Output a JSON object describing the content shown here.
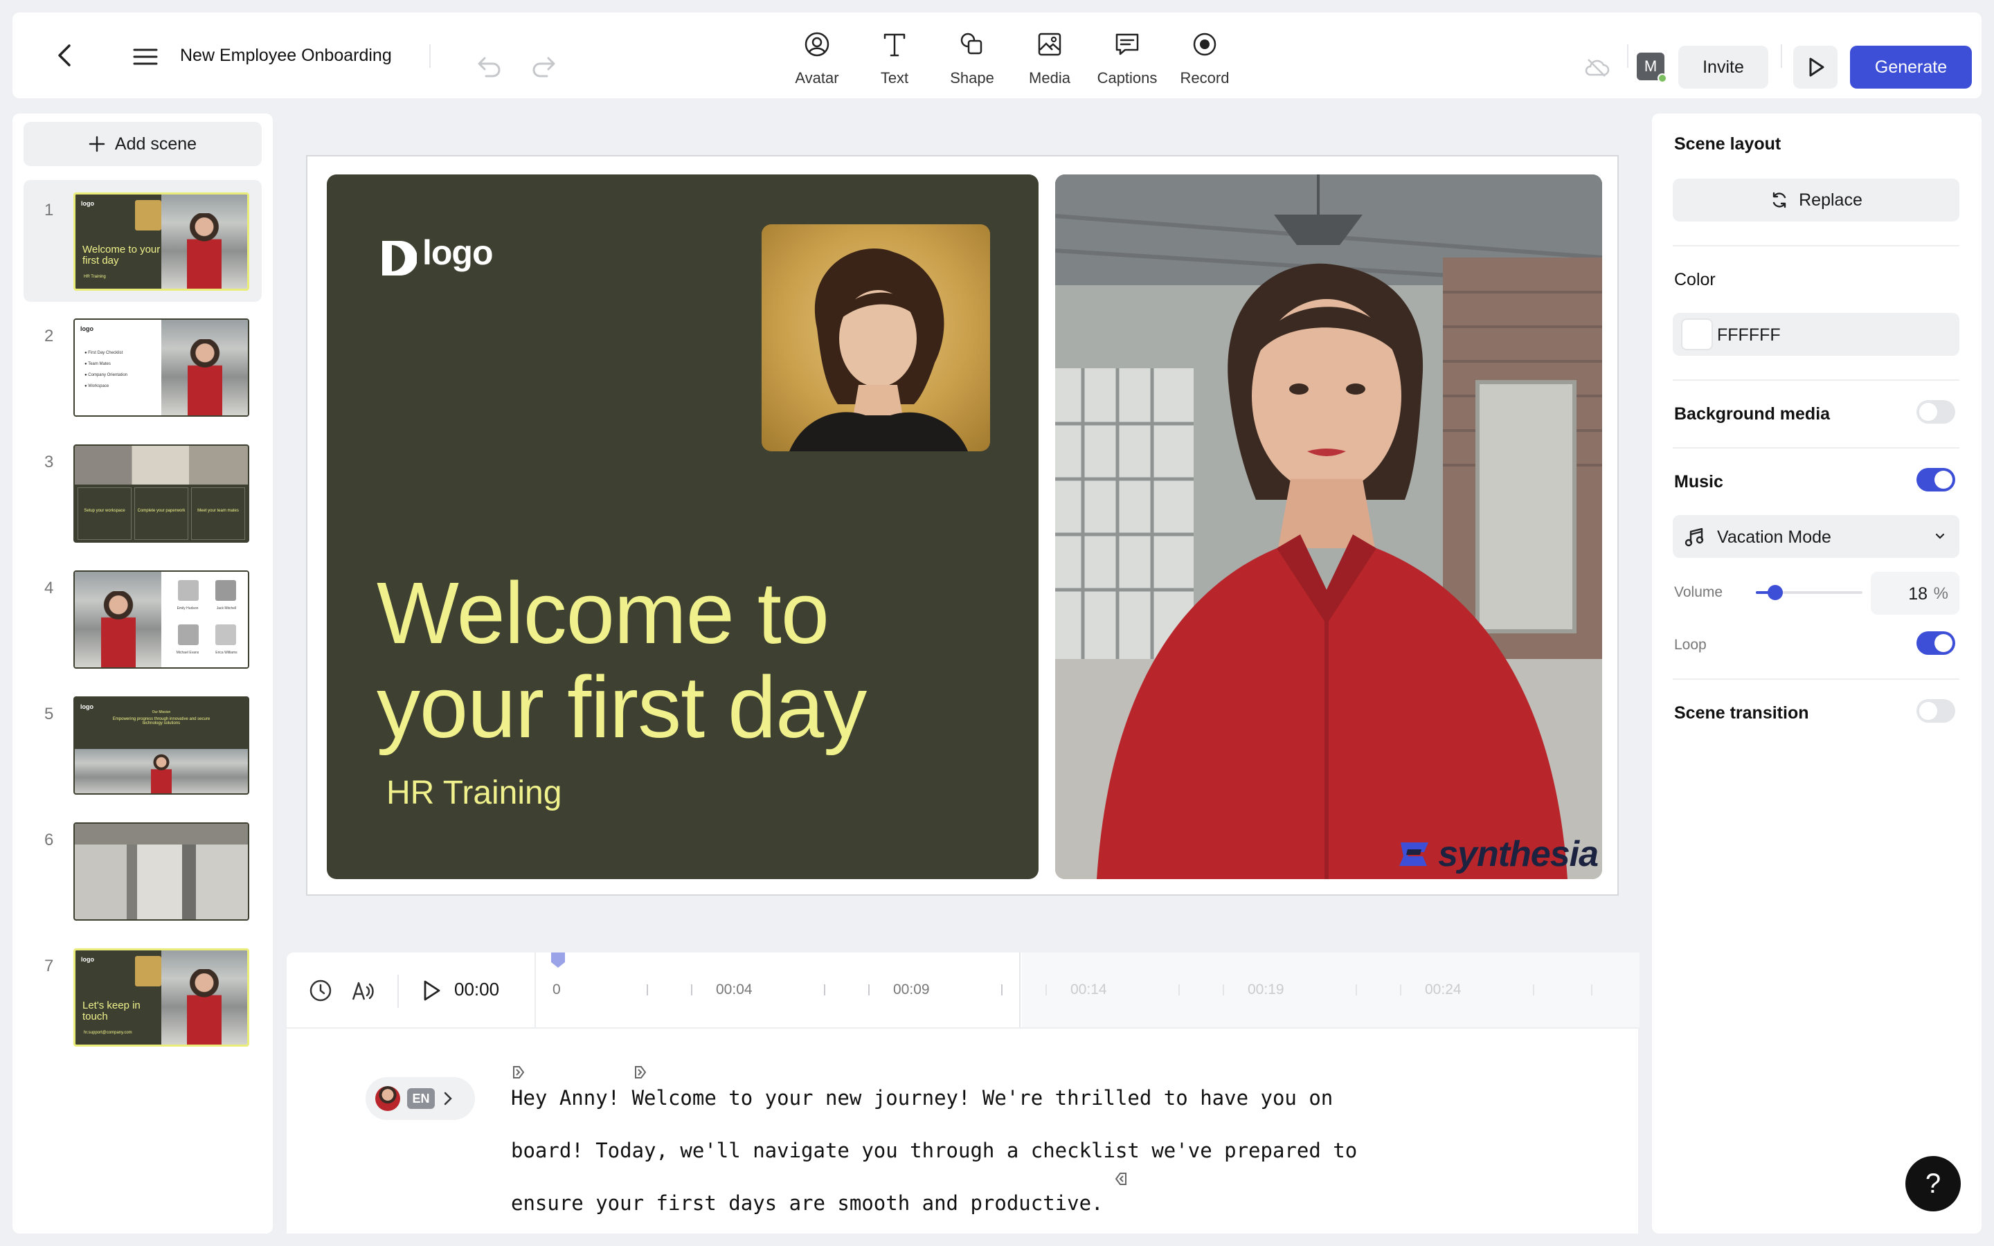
{
  "header": {
    "project_title": "New Employee Onboarding",
    "tools": [
      {
        "label": "Avatar",
        "icon": "avatar-icon"
      },
      {
        "label": "Text",
        "icon": "text-icon"
      },
      {
        "label": "Shape",
        "icon": "shape-icon"
      },
      {
        "label": "Media",
        "icon": "media-icon"
      },
      {
        "label": "Captions",
        "icon": "captions-icon"
      },
      {
        "label": "Record",
        "icon": "record-icon"
      }
    ],
    "user_initial": "M",
    "invite_label": "Invite",
    "generate_label": "Generate",
    "accent_color": "#3c4fd6"
  },
  "sidebar": {
    "add_scene_label": "Add scene",
    "scenes": [
      {
        "number": "1",
        "title": "Welcome to your first day",
        "subtitle": "HR Training",
        "logo": "logo"
      },
      {
        "number": "2",
        "logo": "logo",
        "items": [
          "First Day Checklist",
          "Team Mates",
          "Company Orientation",
          "Workspace"
        ]
      },
      {
        "number": "3",
        "cards": [
          "Setup your workspace",
          "Complete your paperwork",
          "Meet your team mates"
        ]
      },
      {
        "number": "4",
        "people": [
          "Emily Hudson",
          "Jack Mitchell",
          "Michael Evans",
          "Erica Williams"
        ]
      },
      {
        "number": "5",
        "logo": "logo",
        "caption_small": "Empowering progress through innovative and secure technology solutions",
        "eyebrow": "Our Mission"
      },
      {
        "number": "6"
      },
      {
        "number": "7",
        "title": "Let's keep in touch",
        "subtitle": "hr.support@company.com",
        "logo": "logo"
      }
    ]
  },
  "canvas": {
    "logo_text": "logo",
    "headline": "Welcome to your first day",
    "subheadline": "HR Training",
    "watermark": "synthesia",
    "slide_bg_color": "#3e4131",
    "headline_color": "#f0f18c"
  },
  "timeline": {
    "current_time": "00:00",
    "labels": [
      "0",
      "00:04",
      "00:09",
      "00:14",
      "00:19",
      "00:24"
    ]
  },
  "script": {
    "language": "EN",
    "lines": [
      "Hey Anny! Welcome to your new journey! We're thrilled to have you on",
      "board! Today, we'll navigate you through a checklist we've prepared to",
      "ensure your first days are smooth and productive."
    ]
  },
  "properties": {
    "scene_layout_label": "Scene layout",
    "replace_label": "Replace",
    "color_label": "Color",
    "color_value": "FFFFFF",
    "background_media_label": "Background media",
    "background_media_on": false,
    "music_label": "Music",
    "music_on": true,
    "music_track": "Vacation Mode",
    "volume_label": "Volume",
    "volume_value": "18",
    "volume_unit": "%",
    "loop_label": "Loop",
    "loop_on": true,
    "scene_transition_label": "Scene transition",
    "scene_transition_on": false
  },
  "help_label": "?"
}
